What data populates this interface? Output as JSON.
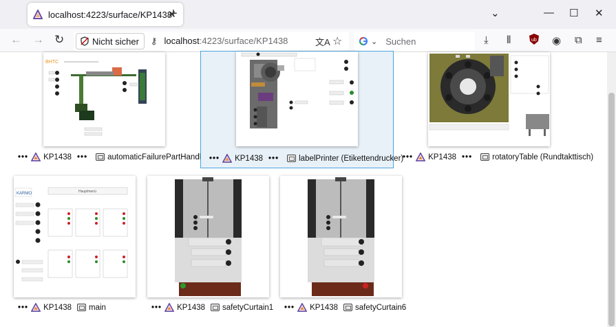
{
  "browser": {
    "tab_title": "localhost:4223/surface/KP1438",
    "not_secure_label": "Nicht sicher",
    "url_host": "localhost",
    "url_path": ":4223/surface/KP1438",
    "search_placeholder": "Suchen",
    "search_engine_icon": "google-g-icon"
  },
  "surfaces": [
    {
      "project": "KP1438",
      "name": "automaticFailurePartHandling",
      "selected": false
    },
    {
      "project": "KP1438",
      "name": "labelPrinter (Etikettendrucker)",
      "selected": true
    },
    {
      "project": "KP1438",
      "name": "rotatoryTable (Rundtakttisch)",
      "selected": false
    },
    {
      "project": "KP1438",
      "name": "main",
      "selected": false
    },
    {
      "project": "KP1438",
      "name": "safetyCurtain1",
      "selected": false
    },
    {
      "project": "KP1438",
      "name": "safetyCurtain6",
      "selected": false
    }
  ],
  "thumb_texts": {
    "bhtc_logo": "BHTC",
    "karmo_logo": "KARMO",
    "main_header": "Hauptmenü"
  },
  "colors": {
    "accent_selected": "#4aa3df",
    "selected_bg": "#e8f1f8"
  }
}
